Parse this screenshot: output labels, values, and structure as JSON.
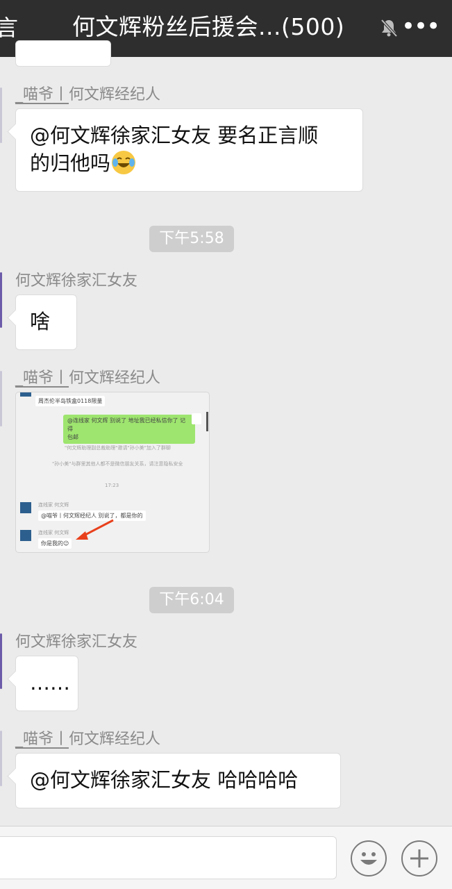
{
  "header": {
    "back_text": "言",
    "title": "何文辉粉丝后援会...(500)",
    "more": "•••"
  },
  "messages": [
    {
      "sender_tag": "_喵爷丨",
      "sender_role": "何文辉经纪人",
      "text": "@何文辉徐家汇女友 要名正言顺",
      "text2": "的归他吗"
    },
    {
      "timestamp": "下午5:58"
    },
    {
      "sender": "何文辉徐家汇女友",
      "text": "啥"
    },
    {
      "sender_tag": "_喵爷丨",
      "sender_role": "何文辉经纪人",
      "image": {
        "top_line": "周杰伦半岛铁盒0118限量",
        "green_text_1": "@连线家 何文辉 别说了 地址我已经私信你了  记得",
        "green_text_2": "包邮",
        "sys_1": "\"何文辉助理副总裁助理\"邀请\"孙小美\"加入了群聊",
        "sys_2": "\"孙小美\"与群里其他人都不是微信朋友关系，请注意隐私安全",
        "time": "17:23",
        "name_1": "连线家 何文辉",
        "reply_1": "@喵爷丨何文辉经纪人 别说了，都是你的",
        "name_2": "连线家 何文辉",
        "reply_2": "你是我的😉"
      }
    },
    {
      "timestamp": "下午6:04"
    },
    {
      "sender": "何文辉徐家汇女友",
      "text": "……"
    },
    {
      "sender_tag": "_喵爷丨",
      "sender_role": "何文辉经纪人",
      "text": "@何文辉徐家汇女友 哈哈哈哈"
    }
  ],
  "colors": {
    "header_bg": "#2e2e2e",
    "chat_bg": "#ebebeb",
    "bubble_bg": "#ffffff",
    "timestamp_bg": "#cecece",
    "wechat_green": "#9ee56f"
  }
}
